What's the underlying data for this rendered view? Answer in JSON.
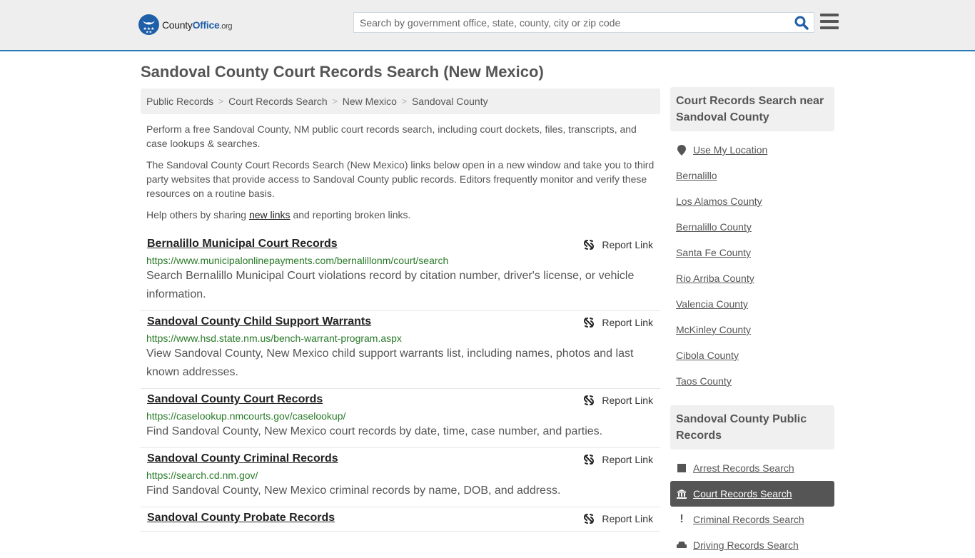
{
  "header": {
    "logo": {
      "county": "County",
      "office": "Office",
      "org": ".org"
    },
    "search_placeholder": "Search by government office, state, county, city or zip code",
    "search_icon": "search-icon",
    "menu_icon": "hamburger-menu-icon"
  },
  "page_title": "Sandoval County Court Records Search (New Mexico)",
  "breadcrumb": [
    "Public Records",
    "Court Records Search",
    "New Mexico",
    "Sandoval County"
  ],
  "intro": {
    "p1": "Perform a free Sandoval County, NM public court records search, including court dockets, files, transcripts, and case lookups & searches.",
    "p2": "The Sandoval County Court Records Search (New Mexico) links below open in a new window and take you to third party websites that provide access to Sandoval County public records. Editors frequently monitor and verify these resources on a routine basis.",
    "p3_before": "Help others by sharing ",
    "p3_link": "new links",
    "p3_after": " and reporting broken links."
  },
  "report_label": "Report Link",
  "results": [
    {
      "title": "Bernalillo Municipal Court Records",
      "url": "https://www.municipalonlinepayments.com/bernalillonm/court/search",
      "desc": "Search Bernalillo Municipal Court violations record by citation number, driver's license, or vehicle information."
    },
    {
      "title": "Sandoval County Child Support Warrants",
      "url": "https://www.hsd.state.nm.us/bench-warrant-program.aspx",
      "desc": "View Sandoval County, New Mexico child support warrants list, including names, photos and last known addresses."
    },
    {
      "title": "Sandoval County Court Records",
      "url": "https://caselookup.nmcourts.gov/caselookup/",
      "desc": "Find Sandoval County, New Mexico court records by date, time, case number, and parties."
    },
    {
      "title": "Sandoval County Criminal Records",
      "url": "https://search.cd.nm.gov/",
      "desc": "Find Sandoval County, New Mexico criminal records by name, DOB, and address."
    },
    {
      "title": "Sandoval County Probate Records",
      "url": "",
      "desc": ""
    }
  ],
  "sidebar": {
    "nearby_title": "Court Records Search near Sandoval County",
    "use_location": "Use My Location",
    "nearby": [
      "Bernalillo",
      "Los Alamos County",
      "Bernalillo County",
      "Santa Fe County",
      "Rio Arriba County",
      "Valencia County",
      "McKinley County",
      "Cibola County",
      "Taos County"
    ],
    "public_title": "Sandoval County Public Records",
    "public_records": [
      {
        "label": "Arrest Records Search",
        "icon": "square-icon",
        "active": false
      },
      {
        "label": "Court Records Search",
        "icon": "courthouse-icon",
        "active": true
      },
      {
        "label": "Criminal Records Search",
        "icon": "exclamation-icon",
        "active": false
      },
      {
        "label": "Driving Records Search",
        "icon": "car-icon",
        "active": false
      }
    ]
  }
}
